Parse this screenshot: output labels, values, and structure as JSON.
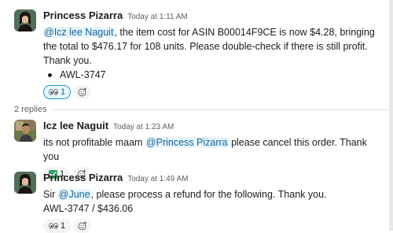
{
  "colors": {
    "mention_bg": "#e8f5fa",
    "mention_fg": "#1264a3",
    "accent": "#1d9bd1"
  },
  "messages": [
    {
      "author": "Princess Pizarra",
      "time": "Today at 1:11 AM",
      "mention": "@Icz lee Naguit",
      "text": ", the item cost for ASIN B00014F9CE is now $4.28, bringing the total to $476.17 for 108 units. Please double-check if there is still profit. Thank you.",
      "bullet": "AWL-3747",
      "reaction_count": "1",
      "reaction_icon": "eyes-icon"
    },
    {
      "author": "Icz lee Naguit",
      "time": "Today at 1:23 AM",
      "text_before": "its not profitable maam ",
      "mention": "@Princess Pizarra",
      "text_after": " please cancel this order. Thank you",
      "reaction_count": "1",
      "reaction_icon": "white-check-mark-icon"
    },
    {
      "author": "Princess Pizarra",
      "time": "Today at 1:49 AM",
      "text_before": "Sir ",
      "mention": "@June",
      "text_after": ", please process a refund for the following. Thank you.",
      "line2": "AWL-3747 / $436.06",
      "reaction_count": "1",
      "reaction_icon": "eyes-icon"
    }
  ],
  "thread": {
    "replies_label": "2 replies"
  }
}
